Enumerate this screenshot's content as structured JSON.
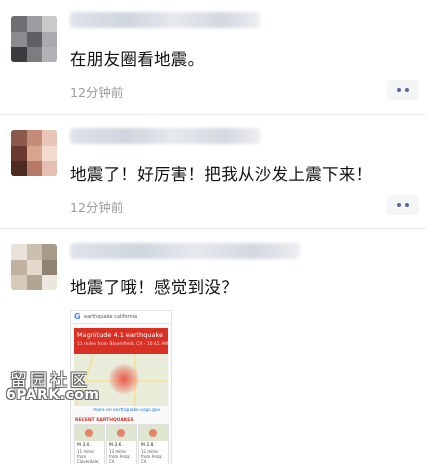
{
  "posts": [
    {
      "text": "在朋友圈看地震。",
      "time": "12分钟前"
    },
    {
      "text": "地震了！好厉害！把我从沙发上震下来！",
      "time": "12分钟前"
    },
    {
      "text": "地震了哦！感觉到没？",
      "image": {
        "search_query": "earthquake california",
        "card_title": "Magnitude 4.1 earthquake",
        "card_subtitle": "11 miles from Bloomfield, CA · 10:41 AM",
        "map_link": "more on earthquake.usgs.gov",
        "recent_label": "RECENT EARTHQUAKES",
        "quakes": [
          {
            "magnitude": "M 3.0",
            "location": "11 miles from Cloverdale, CA"
          },
          {
            "magnitude": "M 3.6",
            "location": "13 miles from Anza, CA"
          },
          {
            "magnitude": "M 2.8",
            "location": "12 miles from Anza, CA"
          }
        ]
      }
    }
  ],
  "watermark": {
    "chinese": "留园社区",
    "url": "6PARK.com"
  },
  "colors": {
    "link_blue": "#576b95",
    "time_gray": "#9b9b9b",
    "alert_red": "#d93025"
  },
  "icons": {
    "more": "more-dots-icon",
    "google": "google-g-icon"
  }
}
